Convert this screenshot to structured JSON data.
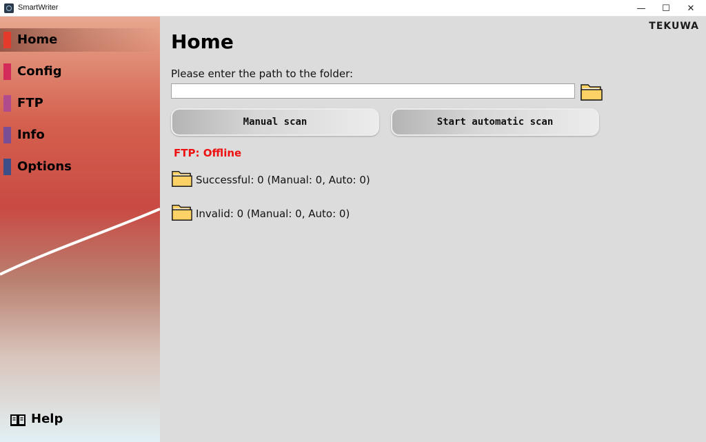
{
  "window": {
    "title": "SmartWriter",
    "minimize_glyph": "—",
    "maximize_glyph": "☐",
    "close_glyph": "✕"
  },
  "sidebar": {
    "items": [
      {
        "label": "Home",
        "color": "#e33a2c",
        "active": true
      },
      {
        "label": "Config",
        "color": "#d42a5a",
        "active": false
      },
      {
        "label": "FTP",
        "color": "#b04b8e",
        "active": false
      },
      {
        "label": "Info",
        "color": "#7a4e94",
        "active": false
      },
      {
        "label": "Options",
        "color": "#3d4f86",
        "active": false
      }
    ],
    "help": {
      "label": "Help",
      "icon": "book-icon"
    }
  },
  "brand": {
    "logo_text": "TEKUWA"
  },
  "main": {
    "title": "Home",
    "path_label": "Please enter the path to the folder:",
    "path_value": "",
    "browse_icon": "folder-icon",
    "manual_scan_label": "Manual scan",
    "auto_scan_label": "Start automatic scan",
    "ftp_status": "FTP: Offline",
    "ftp_status_color": "#ee1111",
    "successful_text": "Successful: 0 (Manual: 0, Auto: 0)",
    "invalid_text": "Invalid: 0 (Manual: 0, Auto: 0)"
  },
  "colors": {
    "folder_fill": "#fcd267",
    "folder_outline": "#1a1a1a"
  }
}
